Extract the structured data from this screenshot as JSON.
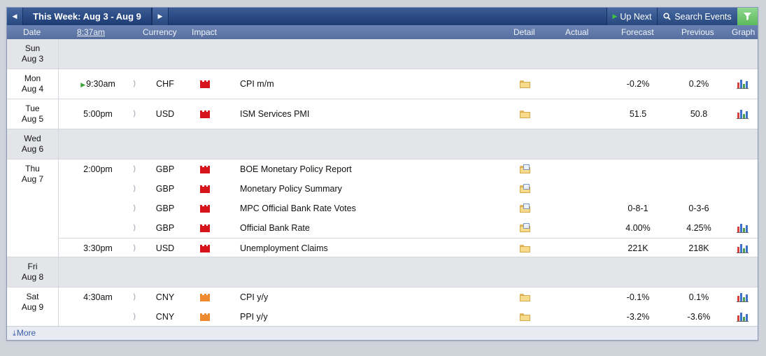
{
  "toolbar": {
    "week_title": "This Week: Aug 3 - Aug 9",
    "up_next_label": "Up Next",
    "search_label": "Search Events"
  },
  "columns": {
    "date": "Date",
    "time": "8:37am",
    "currency": "Currency",
    "impact": "Impact",
    "detail": "Detail",
    "actual": "Actual",
    "forecast": "Forecast",
    "previous": "Previous",
    "graph": "Graph"
  },
  "days": [
    {
      "weekday": "Sun",
      "date": "Aug 3",
      "events": []
    },
    {
      "weekday": "Mon",
      "date": "Aug 4",
      "events": [
        {
          "time": "9:30am",
          "currency": "CHF",
          "impact": "high",
          "event": "CPI m/m",
          "detail": "folder",
          "forecast": "-0.2%",
          "previous": "0.2%",
          "graph": true
        }
      ]
    },
    {
      "weekday": "Tue",
      "date": "Aug 5",
      "events": [
        {
          "time": "5:00pm",
          "currency": "USD",
          "impact": "high",
          "event": "ISM Services PMI",
          "detail": "folder",
          "forecast": "51.5",
          "previous": "50.8",
          "graph": true
        }
      ]
    },
    {
      "weekday": "Wed",
      "date": "Aug 6",
      "events": []
    },
    {
      "weekday": "Thu",
      "date": "Aug 7",
      "events": [
        {
          "time": "2:00pm",
          "currency": "GBP",
          "impact": "high",
          "event": "BOE Monetary Policy Report",
          "detail": "news",
          "forecast": "",
          "previous": "",
          "graph": false
        },
        {
          "time": "",
          "currency": "GBP",
          "impact": "high",
          "event": "Monetary Policy Summary",
          "detail": "news",
          "forecast": "",
          "previous": "",
          "graph": false
        },
        {
          "time": "",
          "currency": "GBP",
          "impact": "high",
          "event": "MPC Official Bank Rate Votes",
          "detail": "news",
          "forecast": "0-8-1",
          "previous": "0-3-6",
          "graph": false
        },
        {
          "time": "",
          "currency": "GBP",
          "impact": "high",
          "event": "Official Bank Rate",
          "detail": "news",
          "forecast": "4.00%",
          "previous": "4.25%",
          "graph": true
        },
        {
          "time": "3:30pm",
          "currency": "USD",
          "impact": "high",
          "event": "Unemployment Claims",
          "detail": "folder",
          "forecast": "221K",
          "previous": "218K",
          "graph": true
        }
      ]
    },
    {
      "weekday": "Fri",
      "date": "Aug 8",
      "events": []
    },
    {
      "weekday": "Sat",
      "date": "Aug 9",
      "events": [
        {
          "time": "4:30am",
          "currency": "CNY",
          "impact": "medium",
          "event": "CPI y/y",
          "detail": "folder",
          "forecast": "-0.1%",
          "previous": "0.1%",
          "graph": true
        },
        {
          "time": "",
          "currency": "CNY",
          "impact": "medium",
          "event": "PPI y/y",
          "detail": "folder",
          "forecast": "-3.2%",
          "previous": "-3.6%",
          "graph": true
        }
      ]
    }
  ],
  "footer": {
    "more_label": "More"
  },
  "colors": {
    "header": "#1e3c74",
    "high_impact": "#d5141b",
    "medium_impact": "#ee8a2f"
  }
}
